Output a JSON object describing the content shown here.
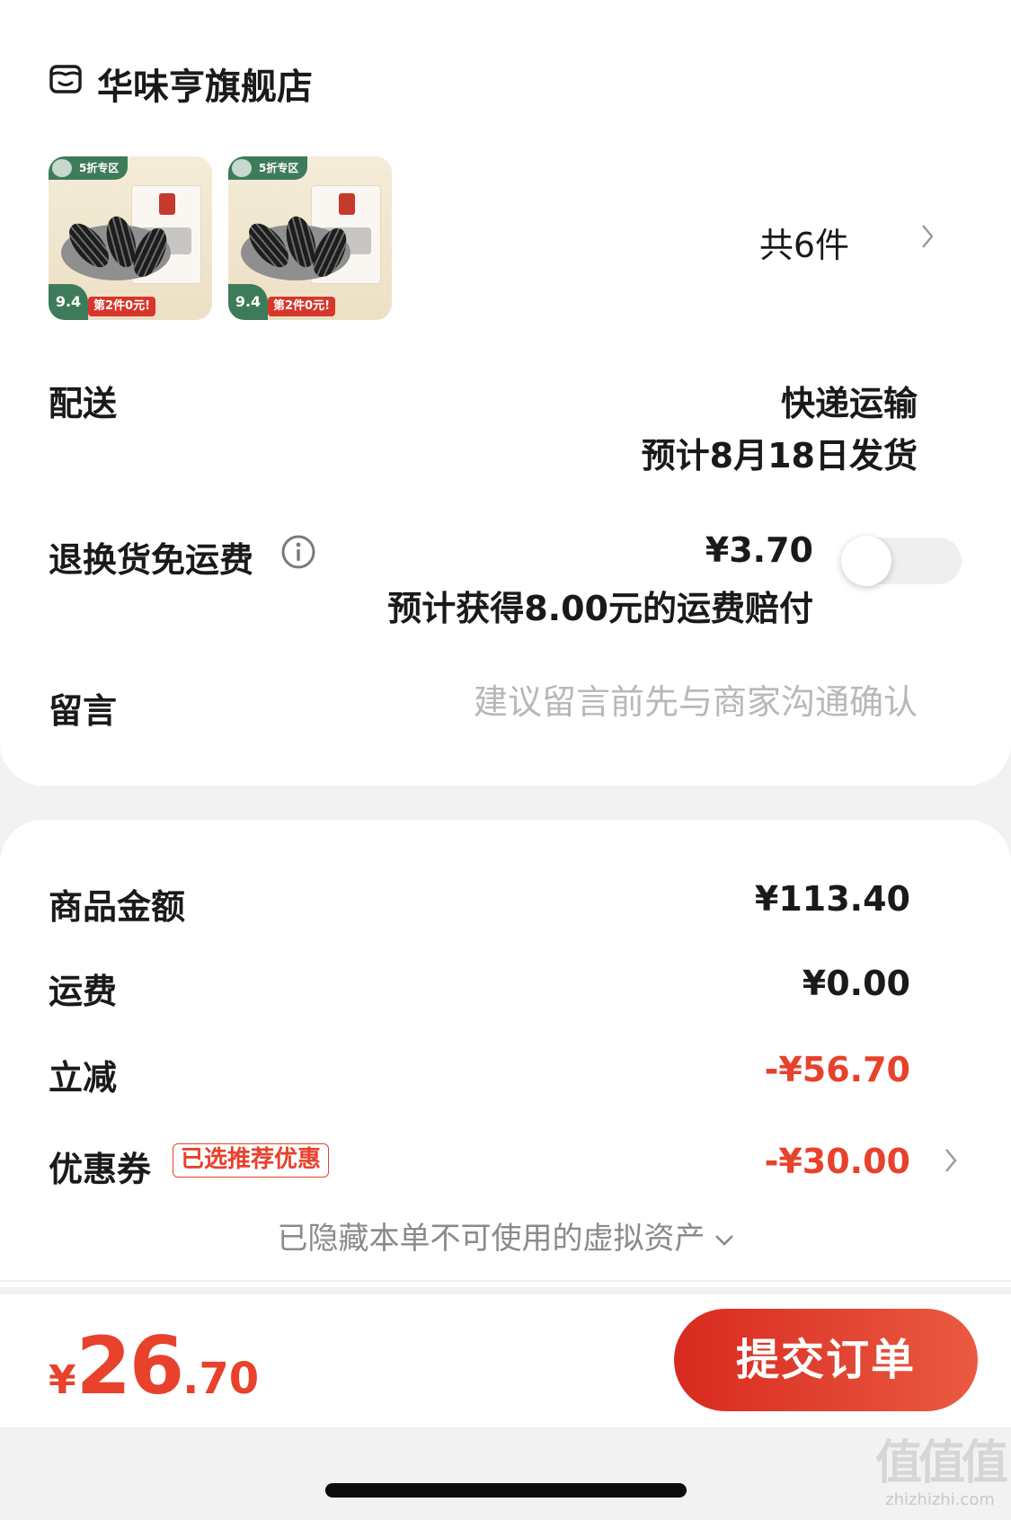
{
  "store": {
    "icon": "store-face-icon",
    "name": "华味亨旗舰店"
  },
  "products": [
    {
      "badge": "5折专区",
      "price_chip": "9.4",
      "promo": "第2件0元!"
    },
    {
      "badge": "5折专区",
      "price_chip": "9.4",
      "promo": "第2件0元!"
    }
  ],
  "item_count": "共6件",
  "delivery": {
    "label": "配送",
    "method": "快递运输",
    "eta": "预计8月18日发货"
  },
  "return_insurance": {
    "label": "退换货免运费",
    "price": "¥3.70",
    "note": "预计获得8.00元的运费赔付",
    "enabled": false
  },
  "message": {
    "label": "留言",
    "placeholder": "建议留言前先与商家沟通确认"
  },
  "summary": {
    "goods_label": "商品金额",
    "goods_value": "¥113.40",
    "freight_label": "运费",
    "freight_value": "¥0.00",
    "discount_label": "立减",
    "discount_value": "-¥56.70",
    "coupon_label": "优惠券",
    "coupon_badge": "已选推荐优惠",
    "coupon_value": "-¥30.00",
    "hidden_assets": "已隐藏本单不可使用的虚拟资产"
  },
  "total": {
    "currency": "¥",
    "integer": "26",
    "decimal": ".70"
  },
  "submit_label": "提交订单",
  "watermark": {
    "glyphs": "值值值",
    "url": "zhizhizhi.com"
  },
  "colors": {
    "accent": "#e8412c",
    "muted": "#b8b8b8"
  }
}
